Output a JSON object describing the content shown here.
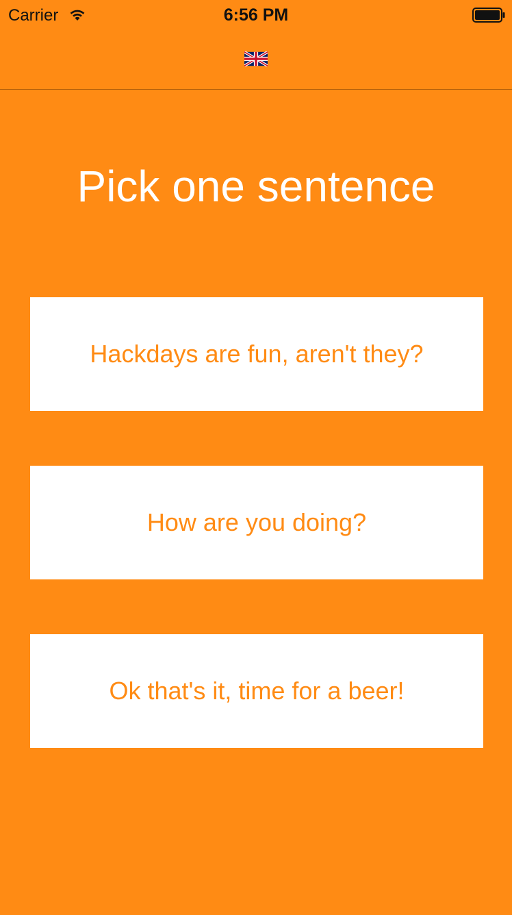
{
  "status_bar": {
    "carrier": "Carrier",
    "time": "6:56 PM",
    "wifi_icon": "wifi-icon",
    "battery_icon": "battery-full-icon"
  },
  "nav_bar": {
    "language_icon": "uk-flag-icon"
  },
  "main": {
    "title": "Pick one sentence",
    "options": [
      {
        "label": "Hackdays are fun, aren't they?"
      },
      {
        "label": "How are you doing?"
      },
      {
        "label": "Ok that's it, time for a beer!"
      }
    ]
  },
  "colors": {
    "background": "#FF8B14",
    "button_background": "#FFFFFF",
    "button_text": "#FF8B14",
    "title_text": "#FFFFFF"
  }
}
